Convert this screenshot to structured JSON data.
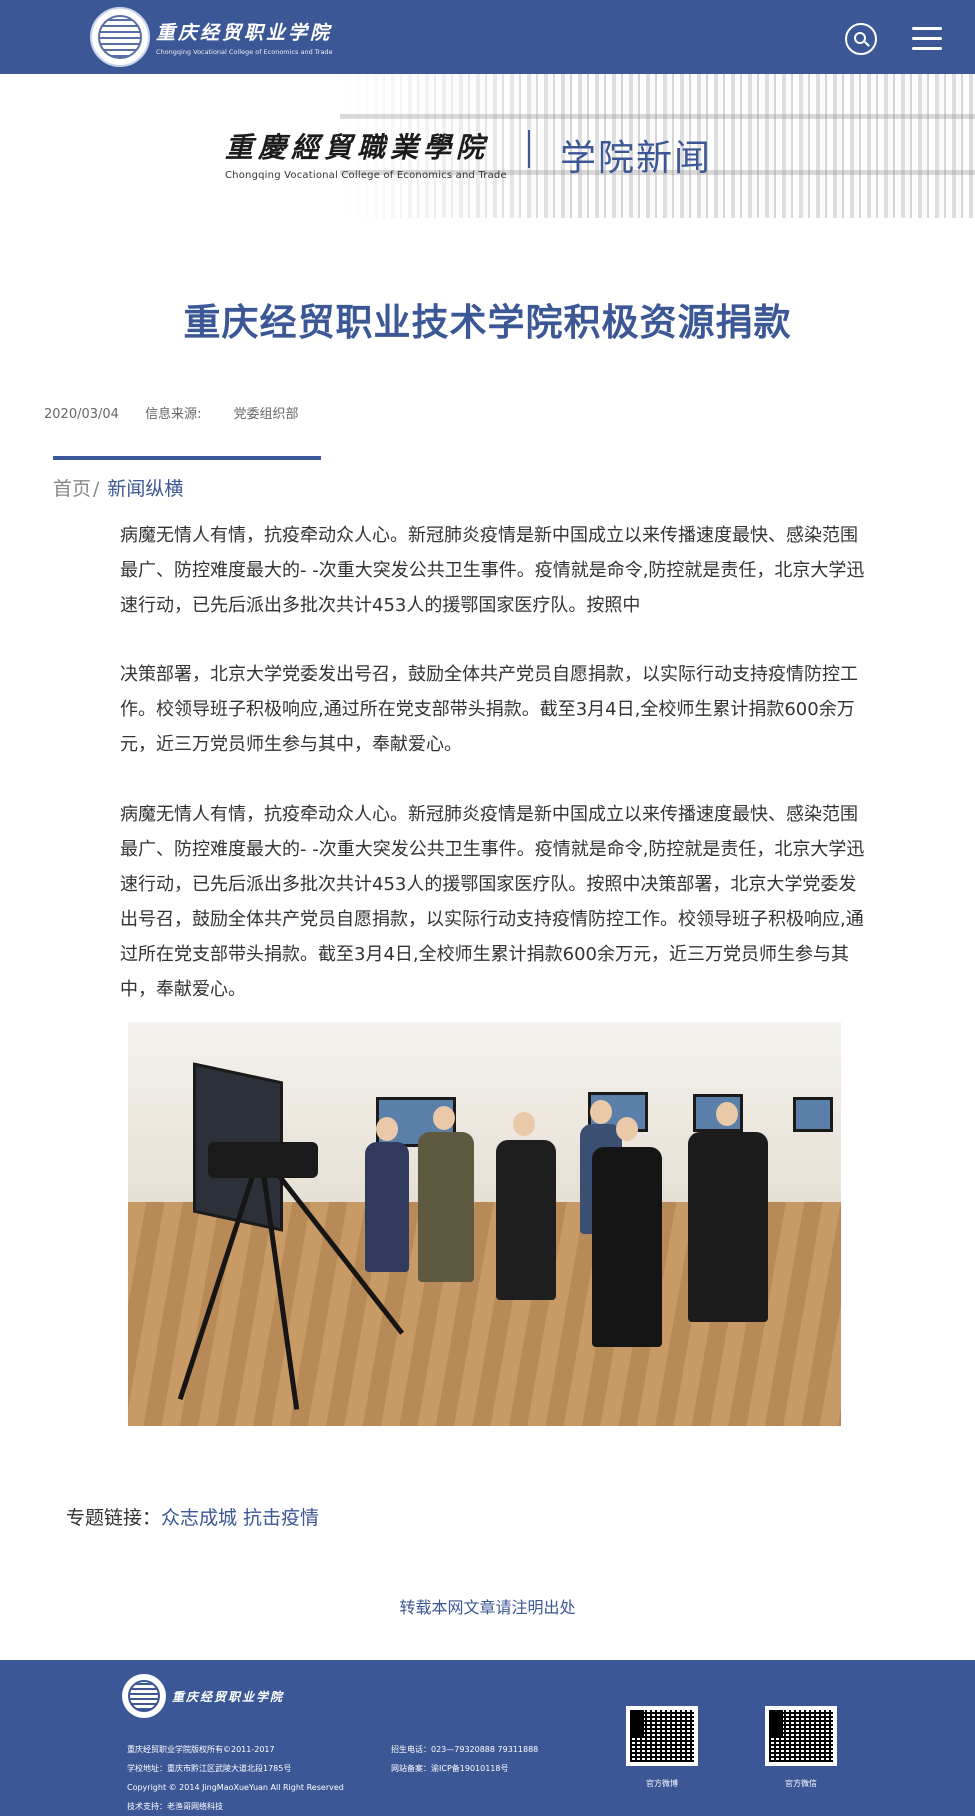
{
  "header": {
    "logo_cn": "重庆经贸职业学院",
    "logo_en": "Chongqing Vocational College of Economics and Trade",
    "search_icon": "search-icon",
    "menu_icon": "hamburger-menu-icon"
  },
  "banner": {
    "brand_cn": "重慶經貿職業學院",
    "brand_en": "Chongqing Vocational College of Economics and Trade",
    "section_title": "学院新闻"
  },
  "article": {
    "title": "重庆经贸职业技术学院积极资源捐款",
    "date": "2020/03/04",
    "source_label": "信息来源:",
    "source_value": "党委组织部",
    "paragraphs": [
      "病魔无情人有情，抗疫牵动众人心。新冠肺炎疫情是新中国成立以来传播速度最快、感染范围最广、防控难度最大的- -次重大突发公共卫生事件。疫情就是命令,防控就是责任，北京大学迅速行动，已先后派出多批次共计453人的援鄂国家医疗队。按照中",
      "决策部署，北京大学党委发出号召，鼓励全体共产党员自愿捐款，以实际行动支持疫情防控工作。校领导班子积极响应,通过所在党支部带头捐款。截至3月4日,全校师生累计捐款600余万元，近三万党员师生参与其中，奉献爱心。",
      "病魔无情人有情，抗疫牵动众人心。新冠肺炎疫情是新中国成立以来传播速度最快、感染范围最广、防控难度最大的- -次重大突发公共卫生事件。疫情就是命令,防控就是责任，北京大学迅速行动，已先后派出多批次共计453人的援鄂国家医疗队。按照中决策部署，北京大学党委发出号召，鼓励全体共产党员自愿捐款，以实际行动支持疫情防控工作。校领导班子积极响应,通过所在党支部带头捐款。截至3月4日,全校师生累计捐款600余万元，近三万党员师生参与其中，奉献爱心。"
    ]
  },
  "breadcrumb": {
    "home": "首页",
    "separator": "/",
    "current": "新闻纵横"
  },
  "topic": {
    "label": "专题链接：",
    "link": "众志成城 抗击疫情"
  },
  "repost_notice": "转载本网文章请注明出处",
  "footer": {
    "logo_cn": "重庆经贸职业学院",
    "left_lines": [
      "重庆经贸职业学院版权所有©2011-2017",
      "学校地址：重庆市黔江区武陵大道北段1785号",
      "Copyright © 2014 JingMaoXueYuan All Right Reserved",
      "技术支持：老渔哥网络科技"
    ],
    "right_lines": [
      "招生电话：023—79320888 79311888",
      "网站备案：渝ICP备19010118号"
    ],
    "qr_weibo_label": "官方微博",
    "qr_wechat_label": "官方微信"
  },
  "colors": {
    "brand_blue": "#3c5796",
    "text": "#333333",
    "meta": "#666666"
  }
}
